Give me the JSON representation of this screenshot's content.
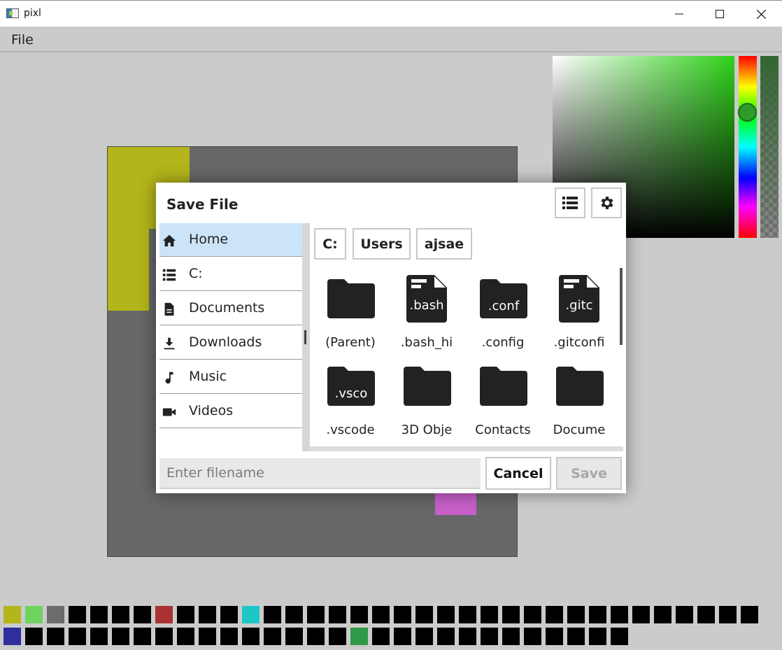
{
  "window": {
    "title": "pixl"
  },
  "menu": {
    "file": "File"
  },
  "dialog": {
    "title": "Save File",
    "places": [
      {
        "label": "Home",
        "icon": "home-icon",
        "active": true
      },
      {
        "label": "C:",
        "icon": "drive-icon"
      },
      {
        "label": "Documents",
        "icon": "document-icon"
      },
      {
        "label": "Downloads",
        "icon": "download-icon"
      },
      {
        "label": "Music",
        "icon": "music-note-icon"
      },
      {
        "label": "Videos",
        "icon": "video-camera-icon"
      }
    ],
    "breadcrumbs": [
      "C:",
      "Users",
      "ajsae"
    ],
    "files": [
      {
        "label": "(Parent)",
        "icon": "folder-icon",
        "badge": ""
      },
      {
        "label": ".bash_hi",
        "icon": "file-icon",
        "badge": ".bash"
      },
      {
        "label": ".config",
        "icon": "folder-icon",
        "badge": ".conf"
      },
      {
        "label": ".gitconfi",
        "icon": "file-icon",
        "badge": ".gitc"
      },
      {
        "label": ".vscode",
        "icon": "folder-icon",
        "badge": ".vsco"
      },
      {
        "label": "3D Obje",
        "icon": "folder-icon",
        "badge": ""
      },
      {
        "label": "Contacts",
        "icon": "folder-icon",
        "badge": ""
      },
      {
        "label": "Docume",
        "icon": "folder-icon",
        "badge": ""
      }
    ],
    "filename_placeholder": "Enter filename",
    "filename_value": "",
    "cancel_label": "Cancel",
    "save_label": "Save"
  },
  "colors": {
    "accent_selected": "#cce4f7",
    "picker_hue": "#2fd219",
    "current_color": "#2e9a2a"
  },
  "palette": {
    "row1": [
      "#b3b51a",
      "#6fd35f",
      "#6b6d6a",
      "#000",
      "#000",
      "#000",
      "#000",
      "#a83232",
      "#000",
      "#000",
      "#000",
      "#1ec7c7",
      "#000",
      "#000",
      "#000",
      "#000",
      "#000",
      "#000",
      "#000",
      "#000",
      "#000",
      "#000",
      "#000",
      "#000",
      "#000",
      "#000",
      "#000",
      "#000",
      "#000",
      "#000",
      "#000",
      "#000",
      "#000",
      "#000",
      "#000"
    ],
    "row2": [
      "#2e2e9e",
      "#000",
      "#000",
      "#000",
      "#000",
      "#000",
      "#000",
      "#000",
      "#000",
      "#000",
      "#000",
      "#000",
      "#000",
      "#000",
      "#000",
      "#000",
      "#2f9a47",
      "#000",
      "#000",
      "#000",
      "#000",
      "#000",
      "#000",
      "#000",
      "#000",
      "#000",
      "#000",
      "#000",
      "#000"
    ]
  }
}
